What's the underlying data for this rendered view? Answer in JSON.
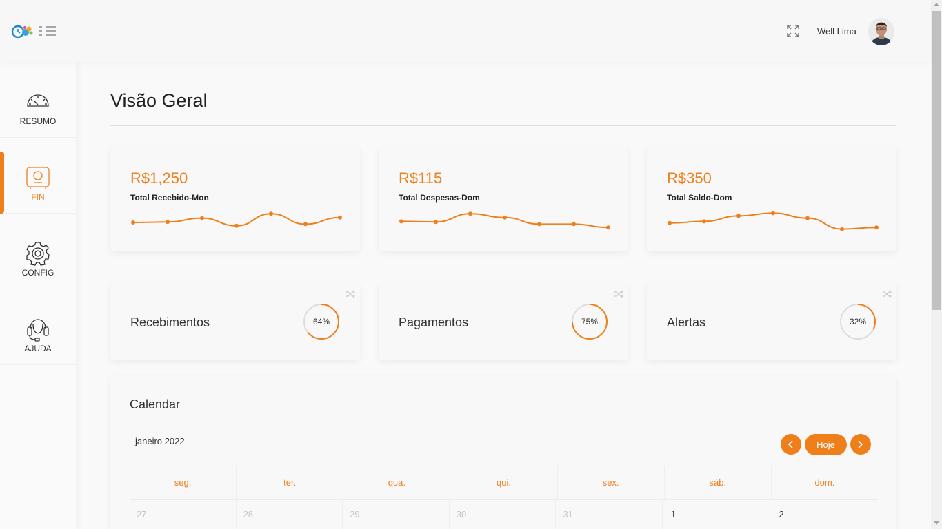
{
  "header": {
    "user_name": "Well Lima",
    "icons": {
      "logo": "app-logo-icon",
      "menu": "menu-toggle-icon",
      "fullscreen": "fullscreen-icon"
    }
  },
  "sidebar": {
    "items": [
      {
        "label": "RESUMO",
        "icon": "speedometer-icon",
        "active": false
      },
      {
        "label": "FIN",
        "icon": "safe-icon",
        "active": true
      },
      {
        "label": "CONFIG",
        "icon": "gear-icon",
        "active": false
      },
      {
        "label": "AJUDA",
        "icon": "headset-icon",
        "active": false
      }
    ]
  },
  "main": {
    "title": "Visão Geral",
    "stats": [
      {
        "value": "R$1,250",
        "label": "Total Recebido-Mon",
        "trend": [
          20,
          21,
          28,
          14,
          36,
          17,
          29
        ]
      },
      {
        "value": "R$115",
        "label": "Total Despesas-Dom",
        "trend": [
          22,
          21,
          36,
          29,
          17,
          17,
          11
        ]
      },
      {
        "value": "R$350",
        "label": "Total Saldo-Dom",
        "trend": [
          19,
          22,
          32,
          37,
          28,
          8,
          11
        ]
      }
    ],
    "progress": [
      {
        "label": "Recebimentos",
        "percent": 64,
        "percent_text": "64%"
      },
      {
        "label": "Pagamentos",
        "percent": 75,
        "percent_text": "75%"
      },
      {
        "label": "Alertas",
        "percent": 32,
        "percent_text": "32%"
      }
    ]
  },
  "calendar": {
    "title": "Calendar",
    "month": "janeiro 2022",
    "today_label": "Hoje",
    "weekdays": [
      "seg.",
      "ter.",
      "qua.",
      "qui.",
      "sex.",
      "sáb.",
      "dom."
    ],
    "first_row": [
      "27",
      "28",
      "29",
      "30",
      "31",
      "1",
      "2"
    ]
  },
  "colors": {
    "accent": "#ef7f1a",
    "text": "#212121",
    "muted": "#c4c4c4"
  }
}
